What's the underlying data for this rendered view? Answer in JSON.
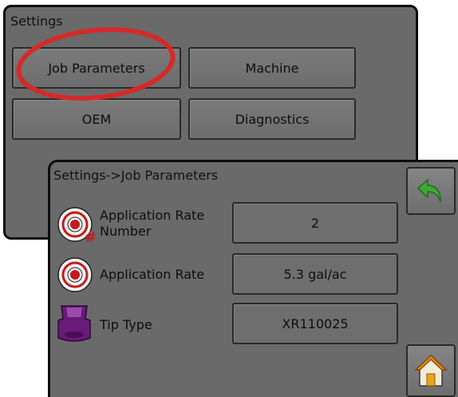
{
  "settings": {
    "title": "Settings",
    "buttons": {
      "job_parameters": "Job Parameters",
      "machine": "Machine",
      "oem": "OEM",
      "diagnostics": "Diagnostics"
    }
  },
  "job_parameters": {
    "title": "Settings->Job Parameters",
    "rows": [
      {
        "label_line1": "Application Rate",
        "label_line2": "Number",
        "value": "2"
      },
      {
        "label": "Application Rate",
        "value": "5.3 gal/ac"
      },
      {
        "label": "Tip Type",
        "value": "XR110025"
      }
    ]
  },
  "icons": {
    "back": "back-arrow-icon",
    "home": "home-icon",
    "target": "target-icon",
    "target_number": "target-number-icon",
    "nozzle": "nozzle-tip-icon"
  },
  "colors": {
    "panel": "#6a6a6a",
    "border": "#0d0d0d",
    "annotation": "#d42a2a",
    "back_arrow": "#3fa83a",
    "target_red": "#c41a1a",
    "nozzle": "#6a1a78"
  }
}
